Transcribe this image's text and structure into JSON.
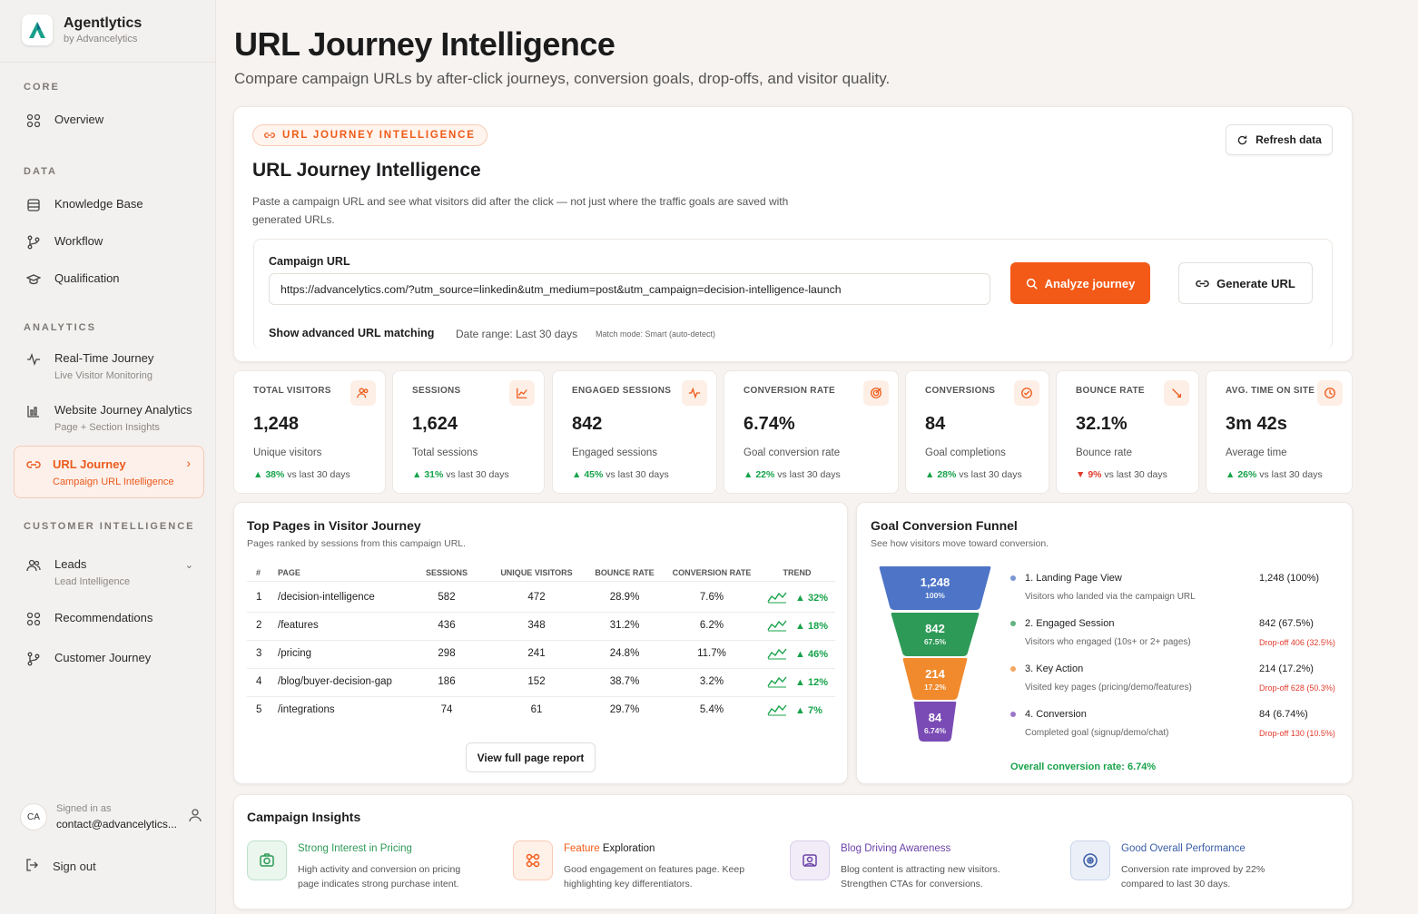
{
  "brand": {
    "name": "Agentlytics",
    "sub": "by Advancelytics",
    "logo_letter": "A"
  },
  "sidebar": {
    "sections": {
      "core": "CORE",
      "data": "DATA",
      "analytics": "ANALYTICS",
      "customer": "CUSTOMER INTELLIGENCE"
    },
    "overview": "Overview",
    "knowledge": "Knowledge Base",
    "workflow": "Workflow",
    "qualification": "Qualification",
    "realtime": {
      "label": "Real-Time Journey",
      "sub": "Live Visitor Monitoring"
    },
    "website": {
      "label": "Website Journey Analytics",
      "sub": "Page + Section Insights"
    },
    "urljourney": {
      "label": "URL Journey",
      "sub": "Campaign URL Intelligence"
    },
    "leads": {
      "label": "Leads",
      "sub": "Lead Intelligence"
    },
    "recommendations": "Recommendations",
    "customer_journey": "Customer Journey",
    "user": {
      "initials": "CA",
      "signed": "Signed in as",
      "email": "contact@advancelytics..."
    },
    "signout": "Sign out"
  },
  "page": {
    "title": "URL Journey Intelligence",
    "subtitle": "Compare campaign URLs by after-click journeys, conversion goals, drop-offs, and visitor quality."
  },
  "panel": {
    "pill": "URL JOURNEY INTELLIGENCE",
    "refresh": "Refresh data",
    "title": "URL Journey Intelligence",
    "desc": "Paste a campaign URL and see what visitors did after the click — not just where the traffic goals are saved with generated URLs.",
    "url_label": "Campaign URL",
    "url_value": "https://advancelytics.com/?utm_source=linkedin&utm_medium=post&utm_campaign=decision-intelligence-launch",
    "analyze": "Analyze journey",
    "generate": "Generate URL",
    "advanced": "Show advanced URL matching",
    "date_range": "Date range: Last 30 days",
    "match_mode": "Match mode: Smart (auto-detect)"
  },
  "kpis": [
    {
      "title": "TOTAL VISITORS",
      "value": "1,248",
      "desc": "Unique visitors",
      "change": "38%",
      "dir": "up",
      "vs": "vs last 30 days"
    },
    {
      "title": "SESSIONS",
      "value": "1,624",
      "desc": "Total sessions",
      "change": "31%",
      "dir": "up",
      "vs": "vs last 30 days"
    },
    {
      "title": "ENGAGED SESSIONS",
      "value": "842",
      "desc": "Engaged sessions",
      "change": "45%",
      "dir": "up",
      "vs": "vs last 30 days"
    },
    {
      "title": "CONVERSION RATE",
      "value": "6.74%",
      "desc": "Goal conversion rate",
      "change": "22%",
      "dir": "up",
      "vs": "vs last 30 days"
    },
    {
      "title": "CONVERSIONS",
      "value": "84",
      "desc": "Goal completions",
      "change": "28%",
      "dir": "up",
      "vs": "vs last 30 days"
    },
    {
      "title": "BOUNCE RATE",
      "value": "32.1%",
      "desc": "Bounce rate",
      "change": "9%",
      "dir": "down",
      "vs": "vs last 30 days"
    },
    {
      "title": "AVG. TIME ON SITE",
      "value": "3m 42s",
      "desc": "Average time",
      "change": "26%",
      "dir": "up",
      "vs": "vs last 30 days"
    }
  ],
  "top_pages": {
    "title": "Top Pages in Visitor Journey",
    "sub": "Pages ranked by sessions from this campaign URL.",
    "headers": [
      "#",
      "PAGE",
      "SESSIONS",
      "UNIQUE VISITORS",
      "BOUNCE RATE",
      "CONVERSION RATE",
      "TREND"
    ],
    "rows": [
      {
        "n": "1",
        "page": "/decision-intelligence",
        "sessions": "582",
        "uv": "472",
        "bounce": "28.9%",
        "conv": "7.6%",
        "trend": "32%"
      },
      {
        "n": "2",
        "page": "/features",
        "sessions": "436",
        "uv": "348",
        "bounce": "31.2%",
        "conv": "6.2%",
        "trend": "18%"
      },
      {
        "n": "3",
        "page": "/pricing",
        "sessions": "298",
        "uv": "241",
        "bounce": "24.8%",
        "conv": "11.7%",
        "trend": "46%"
      },
      {
        "n": "4",
        "page": "/blog/buyer-decision-gap",
        "sessions": "186",
        "uv": "152",
        "bounce": "38.7%",
        "conv": "3.2%",
        "trend": "12%"
      },
      {
        "n": "5",
        "page": "/integrations",
        "sessions": "74",
        "uv": "61",
        "bounce": "29.7%",
        "conv": "5.4%",
        "trend": "7%"
      }
    ],
    "view_full": "View full page report"
  },
  "funnel": {
    "title": "Goal Conversion Funnel",
    "sub": "See how visitors move toward conversion.",
    "stages": [
      {
        "n": "1,248",
        "p": "100%",
        "label": "1. Landing Page View",
        "desc": "Visitors who landed via the campaign URL",
        "value": "1,248 (100%)",
        "drop": "",
        "color": "#4d74c7"
      },
      {
        "n": "842",
        "p": "67.5%",
        "label": "2. Engaged Session",
        "desc": "Visitors who engaged (10s+ or 2+ pages)",
        "value": "842 (67.5%)",
        "drop": "Drop-off 406 (32.5%)",
        "color": "#2e9a57"
      },
      {
        "n": "214",
        "p": "17.2%",
        "label": "3. Key Action",
        "desc": "Visited key pages (pricing/demo/features)",
        "value": "214 (17.2%)",
        "drop": "Drop-off 628 (50.3%)",
        "color": "#f08a2d"
      },
      {
        "n": "84",
        "p": "6.74%",
        "label": "4. Conversion",
        "desc": "Completed goal (signup/demo/chat)",
        "value": "84 (6.74%)",
        "drop": "Drop-off 130 (10.5%)",
        "color": "#7b4bb5"
      }
    ],
    "overall": "Overall conversion rate: 6.74%"
  },
  "insights": {
    "title": "Campaign Insights",
    "items": [
      {
        "title": "Strong Interest in Pricing",
        "desc": "High activity and conversion on pricing page indicates strong purchase intent.",
        "color": "#2e9a57"
      },
      {
        "title_a": "Feature",
        "title_b": " Exploration",
        "desc": "Good engagement on features page. Keep highlighting key differentiators.",
        "color": "#f35a17"
      },
      {
        "title": "Blog Driving Awareness",
        "desc": "Blog content is attracting new visitors. Strengthen CTAs for conversions.",
        "color": "#6b43a8"
      },
      {
        "title": "Good Overall Performance",
        "desc": "Conversion rate improved by 22% compared to last 30 days.",
        "color": "#3b5ea8"
      }
    ]
  }
}
